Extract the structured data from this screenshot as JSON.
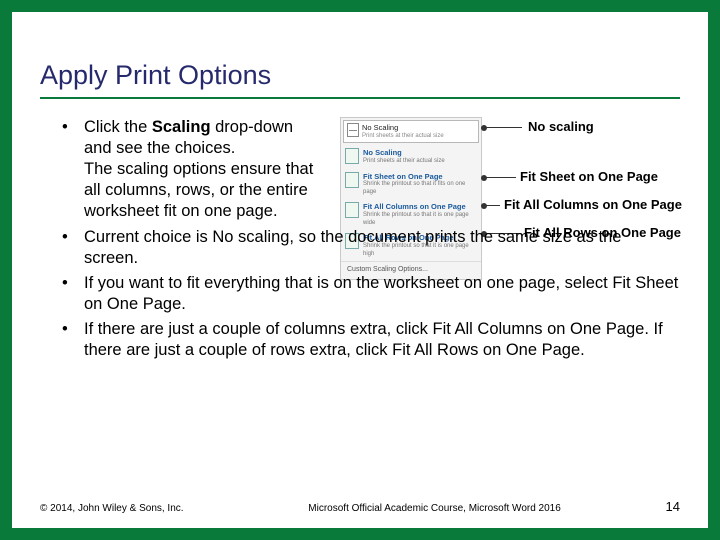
{
  "title": "Apply Print Options",
  "bullets": {
    "b1_pre": "Click the ",
    "b1_bold": "Scaling",
    "b1_post": " drop-down and see the choices.\nThe scaling options ensure that all columns, rows, or the entire worksheet fit on one page.",
    "b2": "Current choice is No scaling, so the document prints the same size as the screen.",
    "b3": "If you want to fit everything that is on the worksheet on one page, select Fit Sheet on One Page.",
    "b4": "If there are just a couple of columns extra, click Fit All Columns on One Page. If there are just a couple of rows extra, click Fit All Rows on One Page."
  },
  "dropdown": {
    "selected_title": "No Scaling",
    "selected_sub": "Print sheets at their actual size",
    "opts": [
      {
        "t1": "No Scaling",
        "t2": "Print sheets at their actual size"
      },
      {
        "t1": "Fit Sheet on One Page",
        "t2": "Shrink the printout so that it fits on one page"
      },
      {
        "t1": "Fit All Columns on One Page",
        "t2": "Shrink the printout so that it is one page wide"
      },
      {
        "t1": "Fit All Rows on One Page",
        "t2": "Shrink the printout so that it is one page high"
      }
    ],
    "footer": "Custom Scaling Options..."
  },
  "callouts": {
    "c1": "No scaling",
    "c2": "Fit Sheet on One Page",
    "c3": "Fit All Columns on One Page",
    "c4": "Fit All Rows on One Page"
  },
  "footer": {
    "left": "© 2014, John Wiley & Sons, Inc.",
    "center": "Microsoft Official Academic Course, Microsoft Word 2016",
    "right": "14"
  }
}
